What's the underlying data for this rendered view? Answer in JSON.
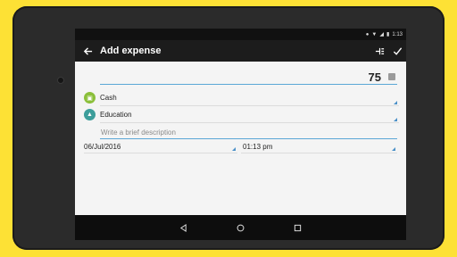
{
  "statusbar": {
    "time": "1:13"
  },
  "toolbar": {
    "title": "Add expense",
    "back_icon": "arrow-left-icon",
    "split_icon": "split-icon",
    "confirm_icon": "check-icon"
  },
  "form": {
    "amount": "75",
    "account": {
      "label": "Cash",
      "icon": "wallet-icon",
      "color": "#8bbf3a"
    },
    "category": {
      "label": "Education",
      "icon": "graduation-cap-icon",
      "color": "#3d9e9b"
    },
    "description_placeholder": "Write a brief description",
    "date": "06/Jul/2016",
    "time": "01:13 pm"
  },
  "colors": {
    "background": "#fde135",
    "toolbar": "#1c1c1c",
    "accent": "#5aa7d6"
  }
}
